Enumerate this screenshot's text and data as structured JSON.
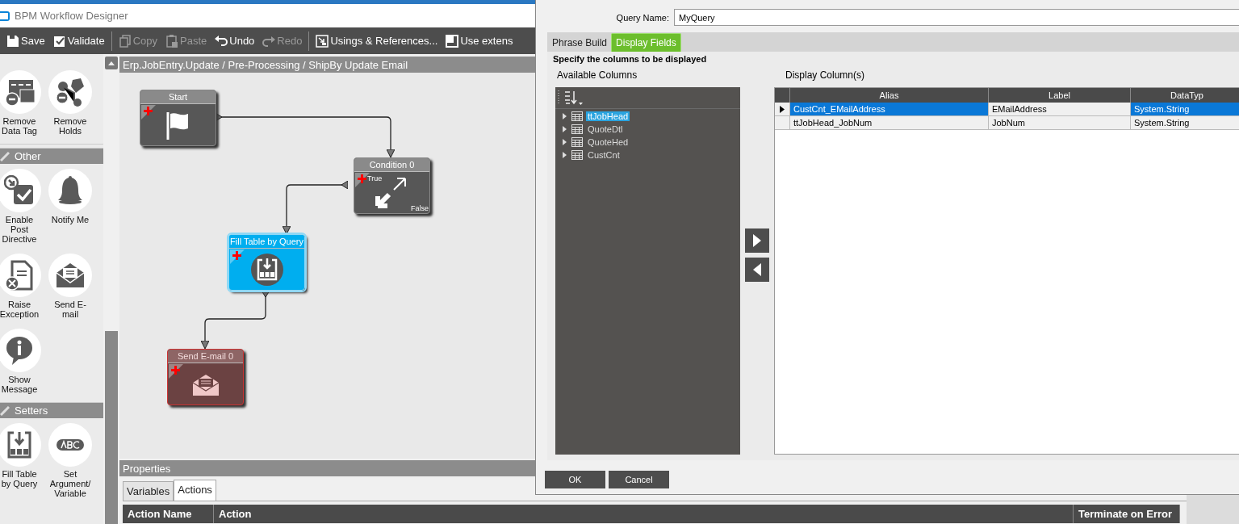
{
  "window": {
    "title": "BPM Workflow Designer"
  },
  "toolbar": [
    {
      "kind": "button",
      "label": "Save",
      "disabled": false
    },
    {
      "kind": "button",
      "label": "Validate",
      "disabled": false
    },
    {
      "kind": "separator"
    },
    {
      "kind": "button",
      "label": "Copy",
      "disabled": true
    },
    {
      "kind": "button",
      "label": "Paste",
      "disabled": true
    },
    {
      "kind": "button",
      "label": "Undo",
      "disabled": false
    },
    {
      "kind": "button",
      "label": "Redo",
      "disabled": true
    },
    {
      "kind": "separator"
    },
    {
      "kind": "button",
      "label": "Usings & References...",
      "disabled": false
    },
    {
      "kind": "button",
      "label": "Use extens",
      "disabled": false
    }
  ],
  "palette": [
    {
      "items": [
        {
          "label": "Remove Data Tag"
        },
        {
          "label": "Remove Holds"
        }
      ]
    },
    {
      "title": "Other",
      "items": [
        {
          "label": "Enable Post Directive"
        },
        {
          "label": "Notify Me"
        },
        {
          "label": "Raise Exception"
        },
        {
          "label": "Send E-mail"
        },
        {
          "label": "Show Message"
        }
      ]
    },
    {
      "title": "Setters",
      "items": [
        {
          "label": "Fill Table by Query"
        },
        {
          "label": "Set Argument/ Variable"
        }
      ]
    }
  ],
  "breadcrumb": "Erp.JobEntry.Update / Pre-Processing / ShipBy Update Email",
  "nodes": [
    {
      "kind": "start",
      "title": "Start",
      "selected": false
    },
    {
      "kind": "condition",
      "title": "Condition 0",
      "true_label": "True",
      "false_label": "False",
      "selected": false
    },
    {
      "kind": "fill-table",
      "title": "Fill Table by Query",
      "selected": true
    },
    {
      "kind": "send-email",
      "title": "Send E-mail 0",
      "selected": false
    }
  ],
  "properties": {
    "title": "Properties",
    "tabs": [
      {
        "label": "Variables",
        "selected": false
      },
      {
        "label": "Actions",
        "selected": true
      }
    ],
    "columns": [
      "Action Name",
      "Action",
      "Terminate on Error"
    ]
  },
  "dialog": {
    "query_name_label": "Query Name:",
    "query_name": "MyQuery",
    "tabs": [
      {
        "label": "Phrase Build",
        "selected": false
      },
      {
        "label": "Display Fields",
        "selected": true
      }
    ],
    "instruction": "Specify the columns to be displayed",
    "available_title": "Available Columns",
    "display_title": "Display Column(s)",
    "tree": [
      {
        "label": "ttJobHead",
        "selected": true,
        "expanded": false
      },
      {
        "label": "QuoteDtl",
        "selected": false,
        "expanded": false
      },
      {
        "label": "QuoteHed",
        "selected": false,
        "expanded": false
      },
      {
        "label": "CustCnt",
        "selected": false,
        "expanded": false
      }
    ],
    "grid": {
      "columns": [
        "Alias",
        "Label",
        "DataTyp"
      ],
      "rows": [
        {
          "cells": [
            "CustCnt_EMailAddress",
            "EMailAddress",
            "System.String"
          ],
          "selected": true
        },
        {
          "cells": [
            "ttJobHead_JobNum",
            "JobNum",
            "System.String"
          ],
          "selected": false
        }
      ]
    },
    "buttons": [
      "OK",
      "Cancel"
    ]
  }
}
